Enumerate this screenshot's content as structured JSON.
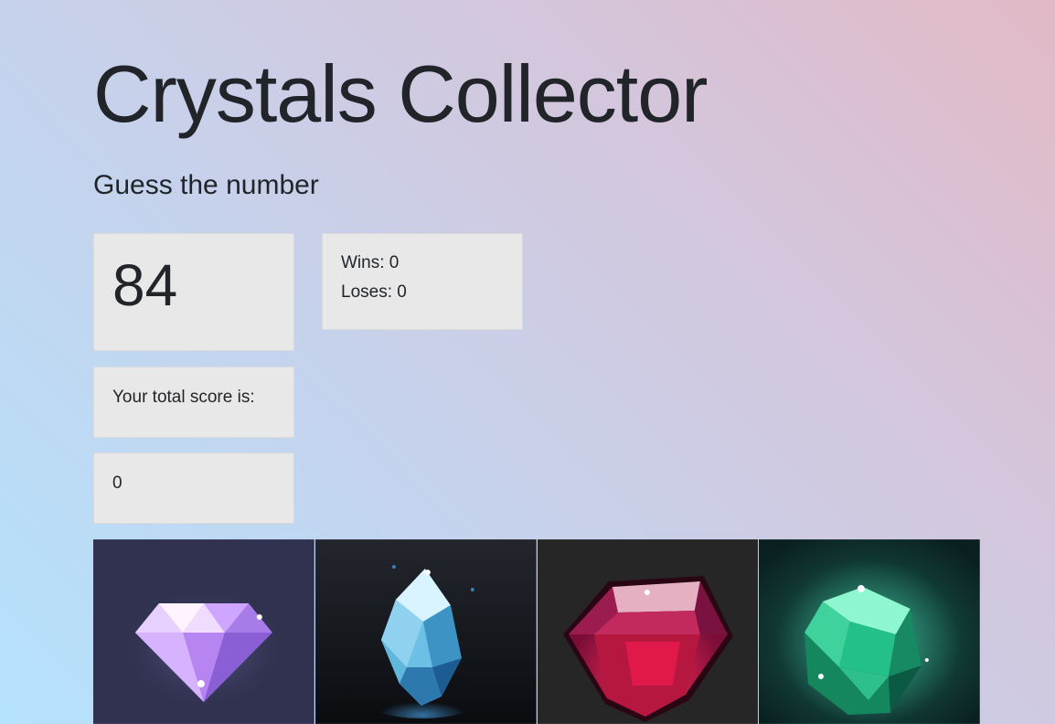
{
  "header": {
    "title": "Crystals Collector",
    "subtitle": "Guess the number"
  },
  "game": {
    "target_number": "84",
    "wins_text": "Wins: 0",
    "loses_text": "Loses: 0",
    "score_label": "Your total score is:",
    "score_value": "0"
  },
  "crystals": [
    {
      "name": "purple-diamond-crystal-icon",
      "background": "#30324f"
    },
    {
      "name": "blue-crystal-icon",
      "background": "#141820"
    },
    {
      "name": "red-ruby-crystal-icon",
      "background": "#262626"
    },
    {
      "name": "green-emerald-crystal-icon",
      "background": "#0e2a2a"
    }
  ],
  "colors": {
    "box_background": "#e8e8e8",
    "text": "#212529"
  }
}
